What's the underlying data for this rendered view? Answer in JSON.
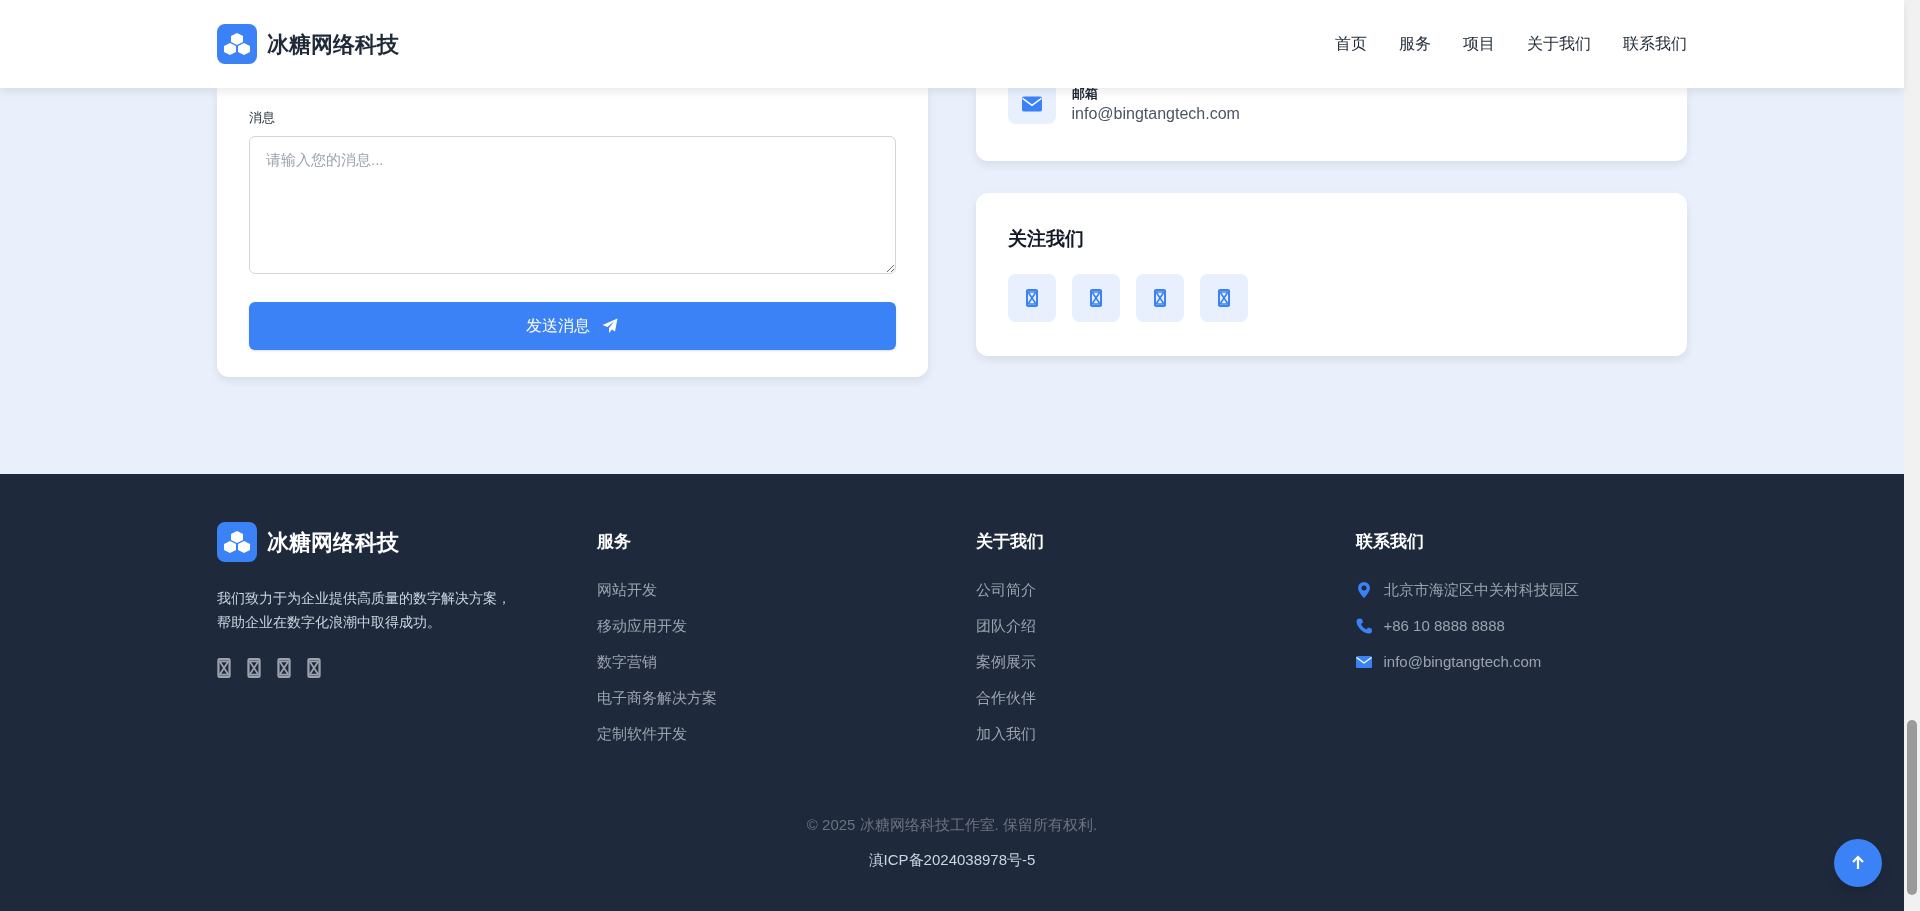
{
  "header": {
    "brand": "冰糖网络科技",
    "nav": [
      {
        "label": "首页"
      },
      {
        "label": "服务"
      },
      {
        "label": "项目"
      },
      {
        "label": "关于我们"
      },
      {
        "label": "联系我们"
      }
    ]
  },
  "form": {
    "message_label": "消息",
    "message_placeholder": "请输入您的消息...",
    "submit": "发送消息"
  },
  "contact_card": {
    "label": "邮箱",
    "value": "info@bingtangtech.com"
  },
  "follow_card": {
    "title": "关注我们",
    "socials": [
      {
        "kind": "social"
      },
      {
        "kind": "social"
      },
      {
        "kind": "social"
      },
      {
        "kind": "social"
      }
    ]
  },
  "footer": {
    "brand": "冰糖网络科技",
    "description": "我们致力于为企业提供高质量的数字解决方案，帮助企业在数字化浪潮中取得成功。",
    "socials": [
      {
        "kind": "social"
      },
      {
        "kind": "social"
      },
      {
        "kind": "social"
      },
      {
        "kind": "social"
      }
    ],
    "columns": [
      {
        "title": "服务",
        "links": [
          "网站开发",
          "移动应用开发",
          "数字营销",
          "电子商务解决方案",
          "定制软件开发"
        ]
      },
      {
        "title": "关于我们",
        "links": [
          "公司简介",
          "团队介绍",
          "案例展示",
          "合作伙伴",
          "加入我们"
        ]
      }
    ],
    "contact": {
      "title": "联系我们",
      "items": [
        {
          "kind": "address",
          "text": "北京市海淀区中关村科技园区"
        },
        {
          "kind": "phone",
          "text": "+86 10 8888 8888"
        },
        {
          "kind": "email",
          "text": "info@bingtangtech.com"
        }
      ]
    },
    "copyright": "© 2025 冰糖网络科技工作室. 保留所有权利.",
    "icp": "滇ICP备2024038978号-5"
  }
}
